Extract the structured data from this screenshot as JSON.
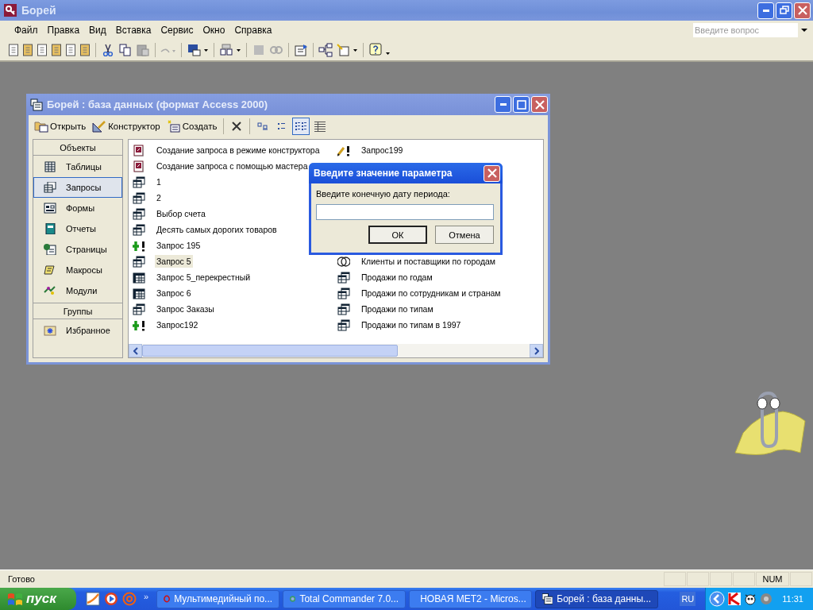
{
  "app_window": {
    "title": "Борей"
  },
  "menu": [
    "Файл",
    "Правка",
    "Вид",
    "Вставка",
    "Сервис",
    "Окно",
    "Справка"
  ],
  "help_box": {
    "placeholder": "Введите вопрос"
  },
  "db_window": {
    "title": "Борей : база данных (формат Access 2000)",
    "toolbar": [
      {
        "kind": "open",
        "label": "Открыть"
      },
      {
        "kind": "design",
        "label": "Конструктор"
      },
      {
        "kind": "new",
        "label": "Создать"
      }
    ],
    "views": [
      {
        "kind": "large",
        "selected": false
      },
      {
        "kind": "small",
        "selected": false
      },
      {
        "kind": "list",
        "selected": true
      },
      {
        "kind": "details",
        "selected": false
      }
    ],
    "sidebar": [
      {
        "kind": "header",
        "label": "Объекты"
      },
      {
        "kind": "tables",
        "label": "Таблицы",
        "selected": false
      },
      {
        "kind": "queries",
        "label": "Запросы",
        "selected": true
      },
      {
        "kind": "forms",
        "label": "Формы",
        "selected": false
      },
      {
        "kind": "reports",
        "label": "Отчеты",
        "selected": false
      },
      {
        "kind": "pages",
        "label": "Страницы",
        "selected": false
      },
      {
        "kind": "macros",
        "label": "Макросы",
        "selected": false
      },
      {
        "kind": "modules",
        "label": "Модули",
        "selected": false
      },
      {
        "kind": "header",
        "label": "Группы"
      },
      {
        "kind": "favorites",
        "label": "Избранное",
        "selected": false
      }
    ],
    "column_1": [
      {
        "kind": "wizard",
        "label": "Создание запроса в режиме конструктора",
        "selected": false
      },
      {
        "kind": "wizard",
        "label": "Создание запроса с помощью мастера",
        "selected": false
      },
      {
        "kind": "select",
        "label": "1",
        "selected": false
      },
      {
        "kind": "select",
        "label": "2",
        "selected": false
      },
      {
        "kind": "select",
        "label": "Выбор счета",
        "selected": false
      },
      {
        "kind": "select",
        "label": "Десять самых дорогих товаров",
        "selected": false
      },
      {
        "kind": "append",
        "label": "Запрос 195",
        "selected": false
      },
      {
        "kind": "select",
        "label": "Запрос 5",
        "selected": true
      },
      {
        "kind": "crosstab",
        "label": "Запрос 5_перекрестный",
        "selected": false
      },
      {
        "kind": "crosstab",
        "label": "Запрос 6",
        "selected": false
      },
      {
        "kind": "select",
        "label": "Запрос Заказы",
        "selected": false
      },
      {
        "kind": "append",
        "label": "Запрос192",
        "selected": false
      }
    ],
    "column_2": [
      {
        "kind": "update",
        "label": "Запрос199",
        "selected": false
      },
      {
        "kind": "union",
        "label": "Клиенты и поставщики по городам",
        "selected": false
      },
      {
        "kind": "select",
        "label": "Продажи по годам",
        "selected": false
      },
      {
        "kind": "select",
        "label": "Продажи по сотрудникам и странам",
        "selected": false
      },
      {
        "kind": "select",
        "label": "Продажи по типам",
        "selected": false
      },
      {
        "kind": "select",
        "label": "Продажи по типам в 1997",
        "selected": false
      }
    ]
  },
  "dialog": {
    "title": "Введите значение параметра",
    "prompt": "Введите конечную дату периода:",
    "buttons": [
      "ОК",
      "Отмена"
    ]
  },
  "status_bar": {
    "text": "Готово",
    "indicator": "NUM"
  },
  "taskbar": {
    "start": "пуск",
    "more": "»",
    "tasks": [
      {
        "kind": "browser",
        "label": "Мультимедийный по...",
        "selected": false
      },
      {
        "kind": "commander",
        "label": "Total Commander 7.0...",
        "selected": false
      },
      {
        "kind": "word",
        "label": "НОВАЯ МЕТ2 - Micros...",
        "selected": false
      },
      {
        "kind": "db",
        "label": "Борей : база данны...",
        "selected": true
      }
    ],
    "language": "RU",
    "clock": "11:31"
  }
}
